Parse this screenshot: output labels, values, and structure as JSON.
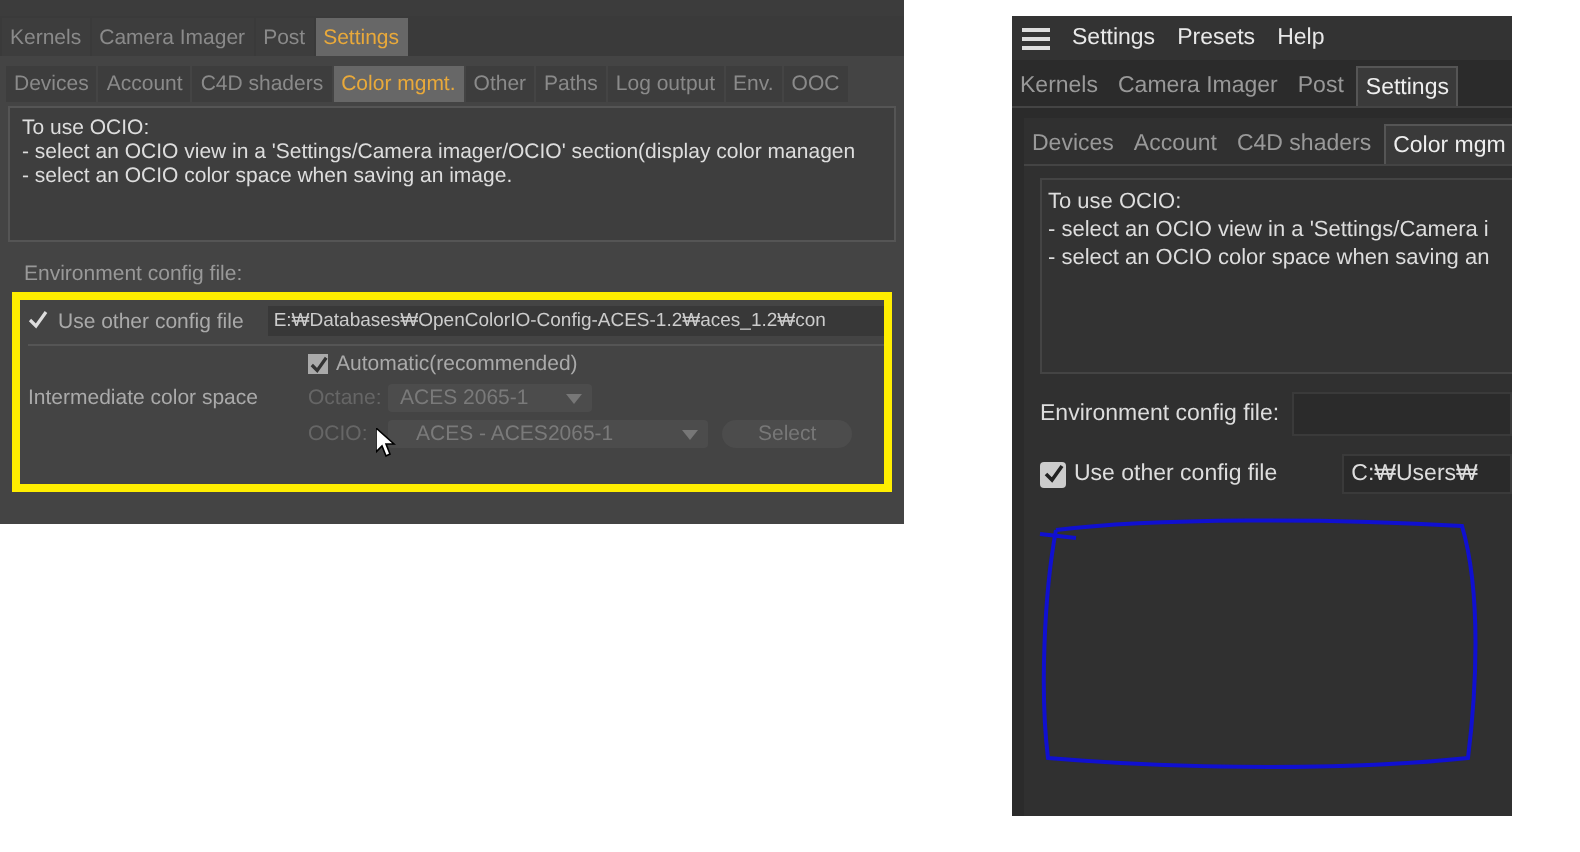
{
  "left_panel": {
    "tabs": [
      {
        "label": "Kernels",
        "selected": false
      },
      {
        "label": "Camera Imager",
        "selected": false
      },
      {
        "label": "Post",
        "selected": false
      },
      {
        "label": "Settings",
        "selected": true
      }
    ],
    "subtabs": [
      {
        "label": "Devices",
        "selected": false
      },
      {
        "label": "Account",
        "selected": false
      },
      {
        "label": "C4D shaders",
        "selected": false
      },
      {
        "label": "Color mgmt.",
        "selected": true
      },
      {
        "label": "Other",
        "selected": false
      },
      {
        "label": "Paths",
        "selected": false
      },
      {
        "label": "Log output",
        "selected": false
      },
      {
        "label": "Env.",
        "selected": false
      },
      {
        "label": "OOC",
        "selected": false
      }
    ],
    "info_lines": [
      "To use OCIO:",
      "- select an OCIO view in a 'Settings/Camera imager/OCIO' section(display color managen",
      "- select an OCIO color space when saving an image."
    ],
    "env_label": "Environment config file:",
    "use_other": {
      "label": "Use other config file",
      "checked": true,
      "path": "E:₩Databases₩OpenColorIO-Config-ACES-1.2₩aces_1.2₩con"
    },
    "intermediate_label": "Intermediate color space",
    "automatic": {
      "label": "Automatic(recommended)",
      "checked": true
    },
    "octane": {
      "label": "Octane:",
      "value": "ACES 2065-1",
      "disabled": true
    },
    "ocio": {
      "label": "OCIO:",
      "value": "ACES - ACES2065-1",
      "disabled": true
    },
    "select_button": {
      "label": "Select",
      "disabled": true
    }
  },
  "right_panel": {
    "menu": [
      "Settings",
      "Presets",
      "Help"
    ],
    "tabs": [
      {
        "label": "Kernels",
        "selected": false
      },
      {
        "label": "Camera Imager",
        "selected": false
      },
      {
        "label": "Post",
        "selected": false
      },
      {
        "label": "Settings",
        "selected": true
      }
    ],
    "subtabs": [
      {
        "label": "Devices",
        "selected": false
      },
      {
        "label": "Account",
        "selected": false
      },
      {
        "label": "C4D shaders",
        "selected": false
      },
      {
        "label": "Color mgm",
        "selected": true
      }
    ],
    "info_lines": [
      "To use OCIO:",
      "- select an OCIO view in a 'Settings/Camera i",
      "- select an OCIO color space when saving an"
    ],
    "env_label": "Environment config file:",
    "use_other": {
      "label": "Use other config file",
      "checked": true,
      "path": "C:₩Users₩"
    }
  }
}
